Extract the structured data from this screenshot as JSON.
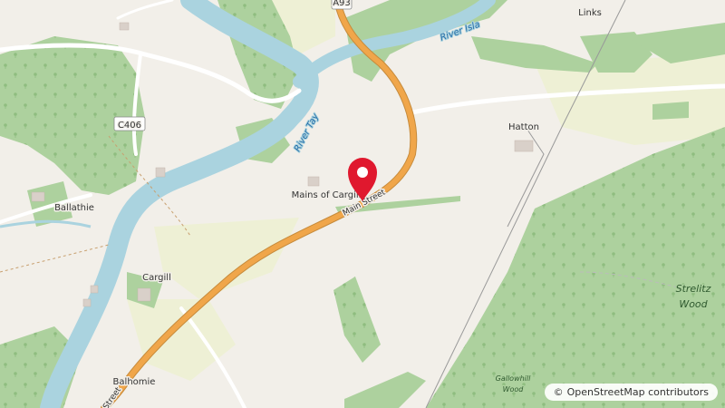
{
  "map": {
    "places": {
      "links": "Links",
      "hatton": "Hatton",
      "ballathie": "Ballathie",
      "mains_of_cargill": "Mains of Cargill",
      "cargill": "Cargill",
      "balhomie": "Balhomie"
    },
    "roads": {
      "a93": "A93",
      "c406": "C406",
      "main_street": "Main Street",
      "street_partial": "Street"
    },
    "water": {
      "river_tay": "River Tay",
      "river_isla": "River Isla"
    },
    "woods": {
      "strelitz_line1": "Strelitz",
      "strelitz_line2": "Wood",
      "gallowhill_line1": "Gallowhill",
      "gallowhill_line2": "Wood"
    },
    "marker_color": "#e0182e",
    "water_color": "#aad3df",
    "wood_color": "#add19e",
    "road_color": "#f0a64a"
  },
  "attribution": {
    "symbol": "©",
    "text": "OpenStreetMap contributors"
  }
}
